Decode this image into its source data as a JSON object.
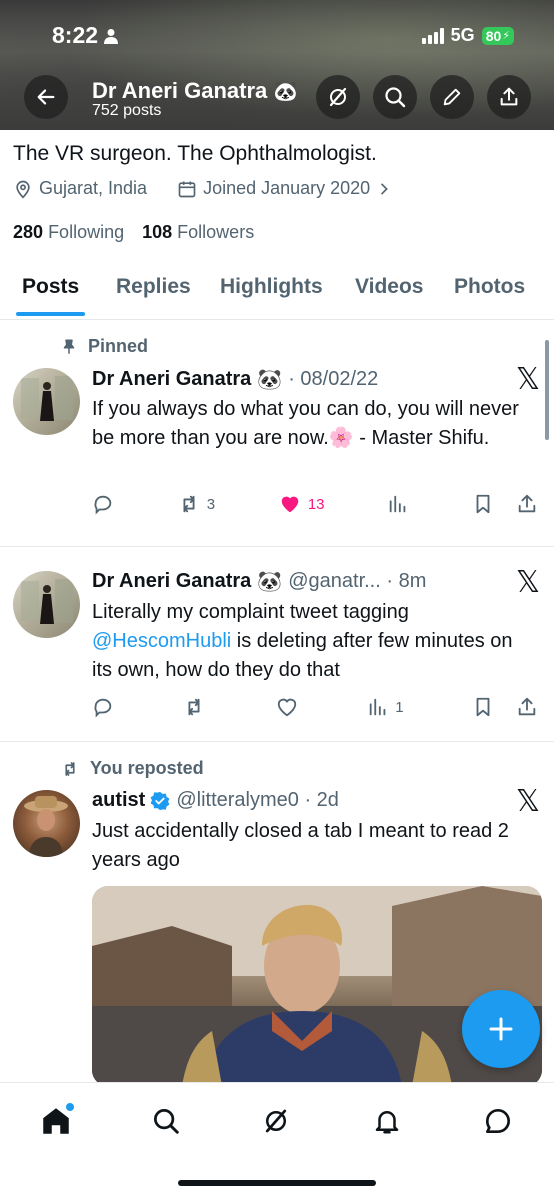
{
  "status_bar": {
    "time": "8:22",
    "network": "5G",
    "battery": "80"
  },
  "profile": {
    "name": "Dr Aneri Ganatra",
    "name_emoji": "🐼",
    "posts_count": "752 posts",
    "bio": "The VR surgeon. The Ophthalmologist.",
    "location": "Gujarat, India",
    "joined": "Joined January 2020",
    "following_count": "280",
    "following_label": "Following",
    "followers_count": "108",
    "followers_label": "Followers"
  },
  "tabs": [
    {
      "label": "Posts",
      "active": true
    },
    {
      "label": "Replies"
    },
    {
      "label": "Highlights"
    },
    {
      "label": "Videos"
    },
    {
      "label": "Photos"
    }
  ],
  "posts": [
    {
      "context": "Pinned",
      "name": "Dr Aneri Ganatra",
      "emoji": "🐼",
      "meta": "· 08/02/22",
      "text": "If you always do what you can do, you will never be more than you are now.🌸       - Master Shifu.",
      "reposts": "3",
      "likes": "13",
      "views": ""
    },
    {
      "name": "Dr Aneri Ganatra",
      "emoji": "🐼",
      "meta": "@ganatr... · 8m",
      "text_before": "Literally my complaint tweet tagging ",
      "mention": "@HescomHubli",
      "text_after": " is deleting after few minutes on its own, how do they do that",
      "views": "1"
    },
    {
      "context": "You reposted",
      "name": "autist",
      "verified": true,
      "meta": "@litteralyme0 · 2d",
      "text": "Just accidentally closed a tab I meant to read 2 years ago"
    }
  ],
  "colors": {
    "accent": "#1d9bf0",
    "like": "#f91880",
    "muted": "#536471"
  }
}
